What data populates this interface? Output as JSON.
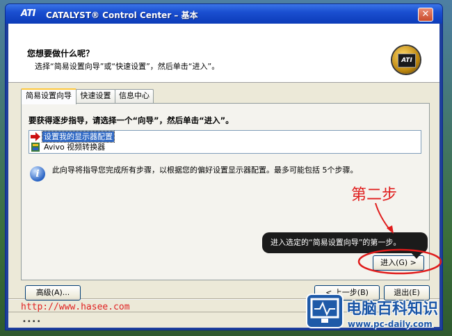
{
  "window": {
    "logo_text": "ATI",
    "title": "CATALYST® Control Center – 基本",
    "close_label": "✕"
  },
  "header": {
    "title": "您想要做什么呢？",
    "subtitle": "选择“简易设置向导”或“快速设置”，然后单击“进入”。",
    "badge_text": "ATI"
  },
  "tabs": [
    {
      "label": "简易设置向导",
      "active": true
    },
    {
      "label": "快速设置",
      "active": false
    },
    {
      "label": "信息中心",
      "active": false
    }
  ],
  "panel": {
    "instruction": "要获得逐步指导，请选择一个“向导”，然后单击“进入”。",
    "items": [
      {
        "label": "设置我的显示器配置",
        "selected": true,
        "icon": "red-arrow-icon"
      },
      {
        "label": "Avivo 视频转换器",
        "selected": false,
        "icon": "film-icon"
      }
    ],
    "info_text": "此向导将指导您完成所有步骤，以根据您的偏好设置显示器配置。最多可能包括 5个步骤。"
  },
  "tooltip": "进入选定的“简易设置向导”的第一步。",
  "buttons": {
    "go": "进入(G) >",
    "advanced": "高级(A)...",
    "back": "< 上一步(B)",
    "exit": "退出(E)"
  },
  "annotation": "第二步",
  "overlay": {
    "url": "http://www.hasee.com",
    "site_name": "电脑百科知识",
    "site_url": "www.pc-daily.com"
  },
  "status": {
    "grip": "••••"
  },
  "colors": {
    "annotation": "#e01b1b",
    "selection": "#316ac5",
    "titlebar": "#1a4fd1"
  }
}
